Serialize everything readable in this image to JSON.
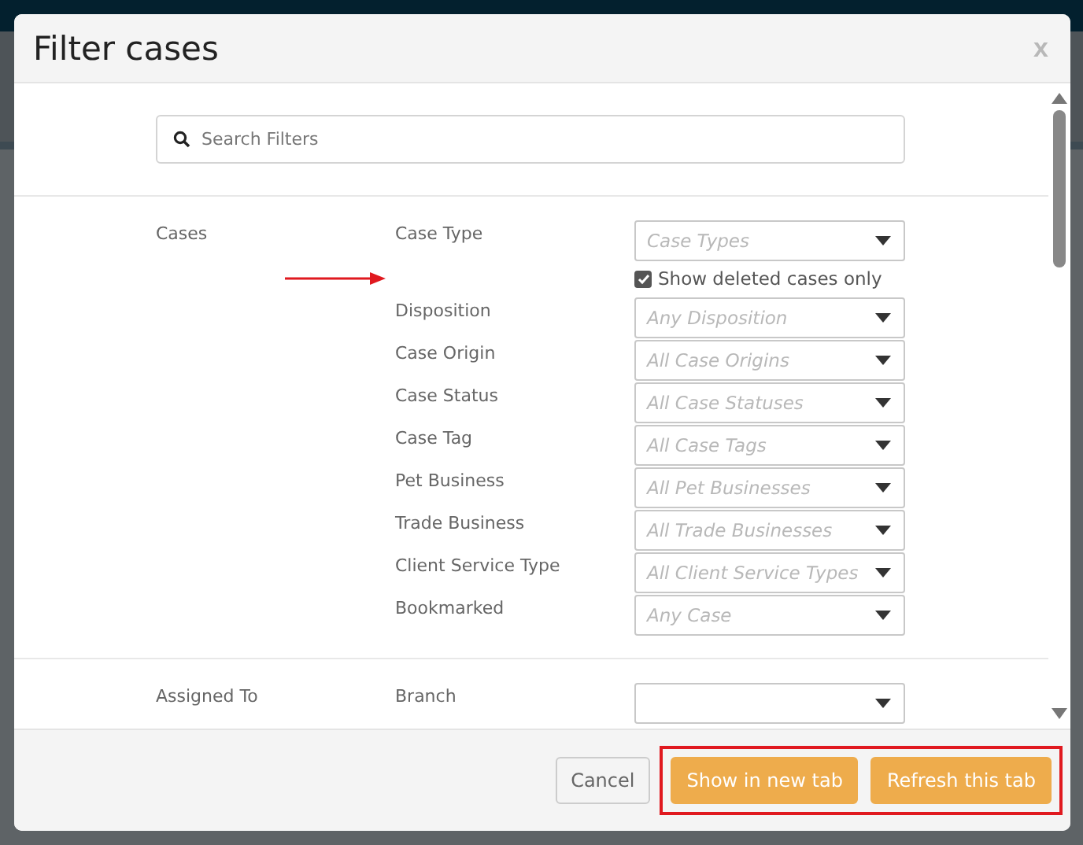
{
  "dialog": {
    "title": "Filter cases",
    "close": "x"
  },
  "search": {
    "placeholder": "Search Filters"
  },
  "sections": [
    {
      "label": "Cases",
      "filters": [
        {
          "kind": "select",
          "label": "Case Type",
          "placeholder": "Case Types"
        },
        {
          "kind": "checkbox",
          "label": "Show deleted cases only",
          "checked": true,
          "annotated": true
        },
        {
          "kind": "select",
          "label": "Disposition",
          "placeholder": "Any Disposition"
        },
        {
          "kind": "select",
          "label": "Case Origin",
          "placeholder": "All Case Origins"
        },
        {
          "kind": "select",
          "label": "Case Status",
          "placeholder": "All Case Statuses"
        },
        {
          "kind": "select",
          "label": "Case Tag",
          "placeholder": "All Case Tags"
        },
        {
          "kind": "select",
          "label": "Pet Business",
          "placeholder": "All Pet Businesses"
        },
        {
          "kind": "select",
          "label": "Trade Business",
          "placeholder": "All Trade Businesses"
        },
        {
          "kind": "select",
          "label": "Client Service Type",
          "placeholder": "All Client Service Types"
        },
        {
          "kind": "select",
          "label": "Bookmarked",
          "placeholder": "Any Case"
        }
      ]
    },
    {
      "label": "Assigned To",
      "filters": [
        {
          "kind": "select",
          "label": "Branch"
        }
      ]
    }
  ],
  "buttons": [
    {
      "label": "Cancel",
      "kind": "secondary",
      "highlighted": false
    },
    {
      "label": "Show in new tab",
      "kind": "primary",
      "highlighted": true
    },
    {
      "label": "Refresh this tab",
      "kind": "primary",
      "highlighted": true
    }
  ]
}
